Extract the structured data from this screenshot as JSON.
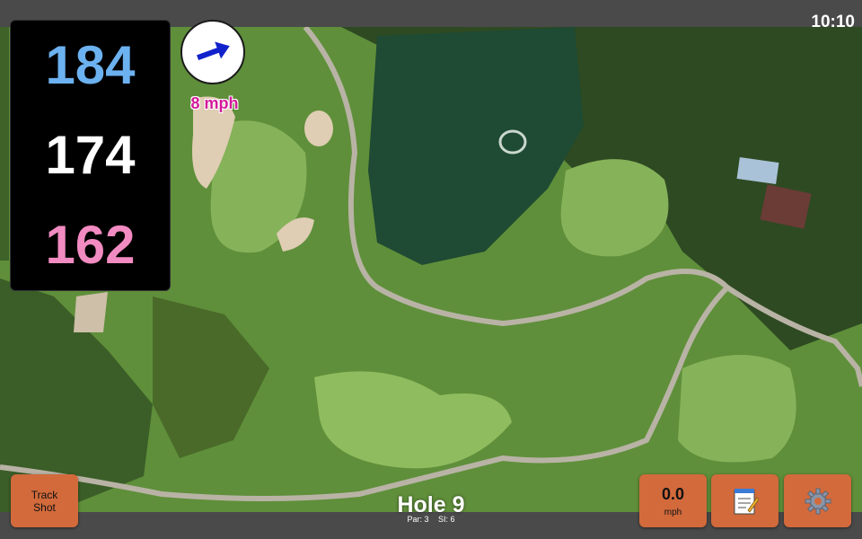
{
  "status": {
    "time": "10:10"
  },
  "distances": {
    "back": "184",
    "center": "174",
    "front": "162"
  },
  "wind": {
    "speed": "8 mph",
    "direction_icon": "arrow-right-icon"
  },
  "hole": {
    "title": "Hole 9",
    "par": "Par: 3",
    "si": "SI: 6"
  },
  "buttons": {
    "track_line1": "Track",
    "track_line2": "Shot",
    "speed_value": "0.0",
    "speed_unit": "mph",
    "notes_icon": "notepad-icon",
    "settings_icon": "gear-icon"
  },
  "colors": {
    "back": "#6cb1f0",
    "center": "#ffffff",
    "front": "#f28bc1",
    "button": "#d26a3c",
    "wind_text": "#d41a9a"
  }
}
